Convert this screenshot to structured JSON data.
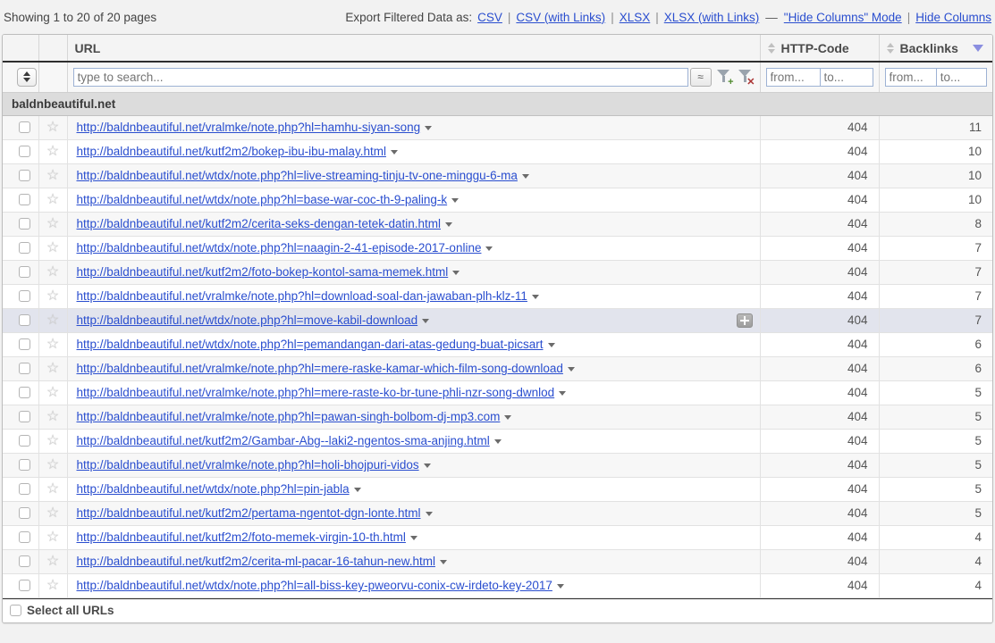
{
  "topbar": {
    "showing_text": "Showing 1 to 20 of 20 pages",
    "export_label": "Export Filtered Data as:",
    "links": [
      {
        "label": "CSV"
      },
      {
        "label": "CSV (with Links)"
      },
      {
        "label": "XLSX"
      },
      {
        "label": "XLSX (with Links)"
      },
      {
        "label": "\"Hide Columns\" Mode"
      },
      {
        "label": "Hide Columns"
      }
    ],
    "separator": "|",
    "dash": "—"
  },
  "table": {
    "columns": {
      "url": "URL",
      "http_code": "HTTP-Code",
      "backlinks": "Backlinks"
    },
    "sort": {
      "active_column": "Backlinks",
      "direction": "desc",
      "indicator_color": "#8a8ee0"
    },
    "filters": {
      "search_placeholder": "type to search...",
      "search_value": "",
      "approx_symbol": "≈",
      "http_from_placeholder": "from...",
      "http_to_placeholder": "to...",
      "http_from_value": "",
      "http_to_value": "",
      "backlinks_from_placeholder": "from...",
      "backlinks_to_placeholder": "to...",
      "backlinks_from_value": "",
      "backlinks_to_value": "",
      "add_filter_icon": "funnel-plus-icon",
      "clear_filter_icon": "funnel-x-icon",
      "spinner_icon": "updown-spinner-icon"
    },
    "group_header": "baldnbeautiful.net",
    "rows": [
      {
        "url": "http://baldnbeautiful.net/vralmke/note.php?hl=hamhu-siyan-song",
        "http_code": "404",
        "backlinks": "11",
        "selected": false,
        "has_plus": false
      },
      {
        "url": "http://baldnbeautiful.net/kutf2m2/bokep-ibu-ibu-malay.html",
        "http_code": "404",
        "backlinks": "10",
        "selected": false,
        "has_plus": false
      },
      {
        "url": "http://baldnbeautiful.net/wtdx/note.php?hl=live-streaming-tinju-tv-one-minggu-6-ma",
        "http_code": "404",
        "backlinks": "10",
        "selected": false,
        "has_plus": false
      },
      {
        "url": "http://baldnbeautiful.net/wtdx/note.php?hl=base-war-coc-th-9-paling-k",
        "http_code": "404",
        "backlinks": "10",
        "selected": false,
        "has_plus": false
      },
      {
        "url": "http://baldnbeautiful.net/kutf2m2/cerita-seks-dengan-tetek-datin.html",
        "http_code": "404",
        "backlinks": "8",
        "selected": false,
        "has_plus": false
      },
      {
        "url": "http://baldnbeautiful.net/wtdx/note.php?hl=naagin-2-41-episode-2017-online",
        "http_code": "404",
        "backlinks": "7",
        "selected": false,
        "has_plus": false
      },
      {
        "url": "http://baldnbeautiful.net/kutf2m2/foto-bokep-kontol-sama-memek.html",
        "http_code": "404",
        "backlinks": "7",
        "selected": false,
        "has_plus": false
      },
      {
        "url": "http://baldnbeautiful.net/vralmke/note.php?hl=download-soal-dan-jawaban-plh-klz-11",
        "http_code": "404",
        "backlinks": "7",
        "selected": false,
        "has_plus": false
      },
      {
        "url": "http://baldnbeautiful.net/wtdx/note.php?hl=move-kabil-download",
        "http_code": "404",
        "backlinks": "7",
        "selected": true,
        "has_plus": true
      },
      {
        "url": "http://baldnbeautiful.net/wtdx/note.php?hl=pemandangan-dari-atas-gedung-buat-picsart",
        "http_code": "404",
        "backlinks": "6",
        "selected": false,
        "has_plus": false
      },
      {
        "url": "http://baldnbeautiful.net/vralmke/note.php?hl=mere-raske-kamar-which-film-song-download",
        "http_code": "404",
        "backlinks": "6",
        "selected": false,
        "has_plus": false
      },
      {
        "url": "http://baldnbeautiful.net/vralmke/note.php?hl=mere-raste-ko-br-tune-phli-nzr-song-dwnlod",
        "http_code": "404",
        "backlinks": "5",
        "selected": false,
        "has_plus": false
      },
      {
        "url": "http://baldnbeautiful.net/vralmke/note.php?hl=pawan-singh-bolbom-dj-mp3.com",
        "http_code": "404",
        "backlinks": "5",
        "selected": false,
        "has_plus": false
      },
      {
        "url": "http://baldnbeautiful.net/kutf2m2/Gambar-Abg--laki2-ngentos-sma-anjing.html",
        "http_code": "404",
        "backlinks": "5",
        "selected": false,
        "has_plus": false
      },
      {
        "url": "http://baldnbeautiful.net/vralmke/note.php?hl=holi-bhojpuri-vidos",
        "http_code": "404",
        "backlinks": "5",
        "selected": false,
        "has_plus": false
      },
      {
        "url": "http://baldnbeautiful.net/wtdx/note.php?hl=pin-jabla",
        "http_code": "404",
        "backlinks": "5",
        "selected": false,
        "has_plus": false
      },
      {
        "url": "http://baldnbeautiful.net/kutf2m2/pertama-ngentot-dgn-lonte.html",
        "http_code": "404",
        "backlinks": "5",
        "selected": false,
        "has_plus": false
      },
      {
        "url": "http://baldnbeautiful.net/kutf2m2/foto-memek-virgin-10-th.html",
        "http_code": "404",
        "backlinks": "4",
        "selected": false,
        "has_plus": false
      },
      {
        "url": "http://baldnbeautiful.net/kutf2m2/cerita-ml-pacar-16-tahun-new.html",
        "http_code": "404",
        "backlinks": "4",
        "selected": false,
        "has_plus": false
      },
      {
        "url": "http://baldnbeautiful.net/wtdx/note.php?hl=all-biss-key-pweorvu-conix-cw-irdeto-key-2017",
        "http_code": "404",
        "backlinks": "4",
        "selected": false,
        "has_plus": false
      }
    ],
    "footer": {
      "select_all_label": "Select all URLs",
      "select_all_checked": false
    },
    "row_icons": {
      "star": "☆",
      "caret": "caret-down-icon",
      "checkbox": "row-checkbox"
    }
  },
  "colors": {
    "link": "#2a4ecf",
    "selected_row": "#e2e4ed",
    "group_header_bg": "#dcdcdc",
    "stripe": "#f7f7f7"
  }
}
